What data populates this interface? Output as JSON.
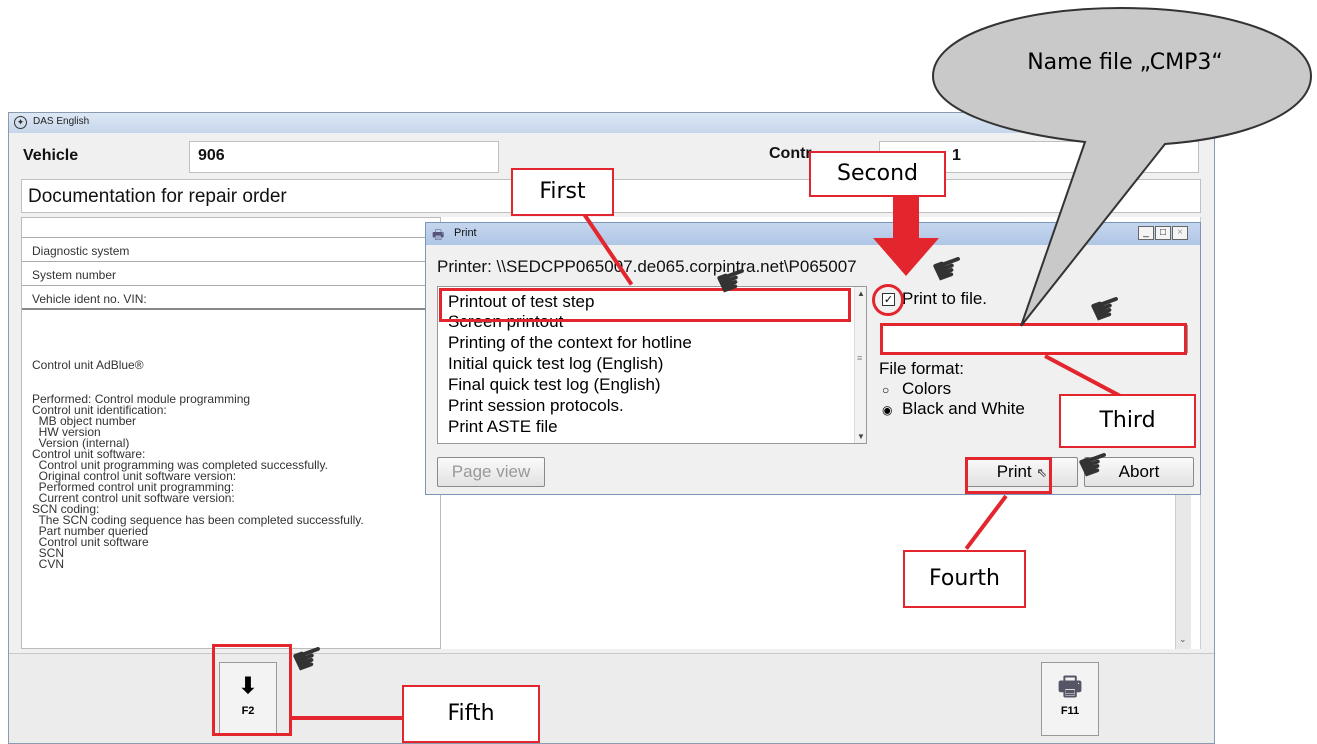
{
  "das_window": {
    "title": "DAS English",
    "vehicle_label": "Vehicle",
    "vehicle_value": "906",
    "control_label": "Contr",
    "control_value_fragment": "1",
    "section_title": "Documentation for repair order",
    "rows": [
      "Diagnostic system",
      "System number",
      "Vehicle ident no. VIN:"
    ],
    "body_lines": [
      "Control unit AdBlue®",
      "",
      "Performed: Control module programming",
      "Control unit identification:",
      "  MB object number",
      "  HW version",
      "  Version (internal)",
      "Control unit software:",
      "  Control unit programming was completed successfully.",
      "  Original control unit software version:",
      "  Performed control unit programming:",
      "  Current control unit software version:",
      "SCN coding:",
      "  The SCN coding sequence has been completed successfully.",
      "  Part number queried",
      "  Control unit software",
      "  SCN",
      "  CVN"
    ],
    "fkeys": {
      "f2_label": "F2",
      "f2_icon": "down-arrow",
      "f11_label": "F11",
      "f11_icon": "printer"
    }
  },
  "print_dialog": {
    "title": "Print",
    "printer_line": "Printer: \\\\SEDCPP065007.de065.corpintra.net\\P065007",
    "options": [
      "Printout of test step",
      "Screen printout",
      "Printing of the context for hotline",
      "Initial quick test log (English)",
      "Final quick test log (English)",
      "Print session protocols.",
      "Print ASTE file"
    ],
    "print_to_file_label": "Print to file.",
    "print_to_file_checked": true,
    "file_name_value": "",
    "file_format_label": "File format:",
    "format_options": [
      "Colors",
      "Black and White"
    ],
    "format_selected": "Black and White",
    "page_view_label": "Page view",
    "print_button_label": "Print",
    "abort_button_label": "Abort"
  },
  "annotations": {
    "callout": "Name file „CMP3“",
    "steps": [
      "First",
      "Second",
      "Third",
      "Fourth",
      "Fifth"
    ],
    "accent_color": "#e3262e"
  }
}
